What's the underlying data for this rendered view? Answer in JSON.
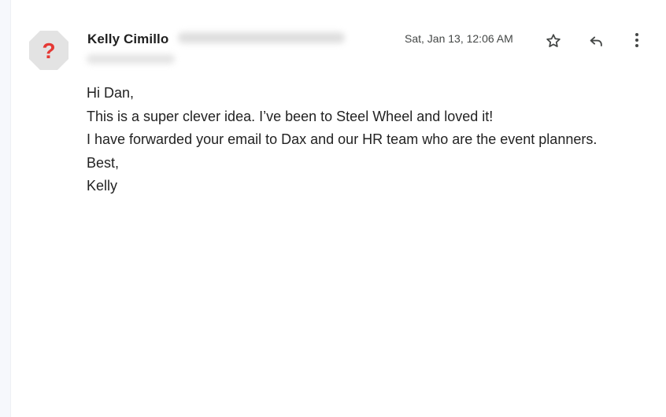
{
  "email": {
    "sender": {
      "name": "Kelly Cimillo",
      "avatar_icon": "question-mark-avatar-icon",
      "avatar_colors": {
        "background": "#e3e3e3",
        "glyph": "#e53935"
      }
    },
    "timestamp": "Sat, Jan 13, 12:06 AM",
    "actions": {
      "star_icon": "star-icon",
      "reply_icon": "reply-icon",
      "more_icon": "more-vertical-icon"
    },
    "body": {
      "greeting": "Hi Dan,",
      "line1": "This is a super clever idea.  I’ve been to Steel Wheel and loved it!",
      "line2": "I have forwarded your email to Dax and our HR team who are the event planners.",
      "closing": "Best,",
      "signature": "Kelly"
    }
  }
}
